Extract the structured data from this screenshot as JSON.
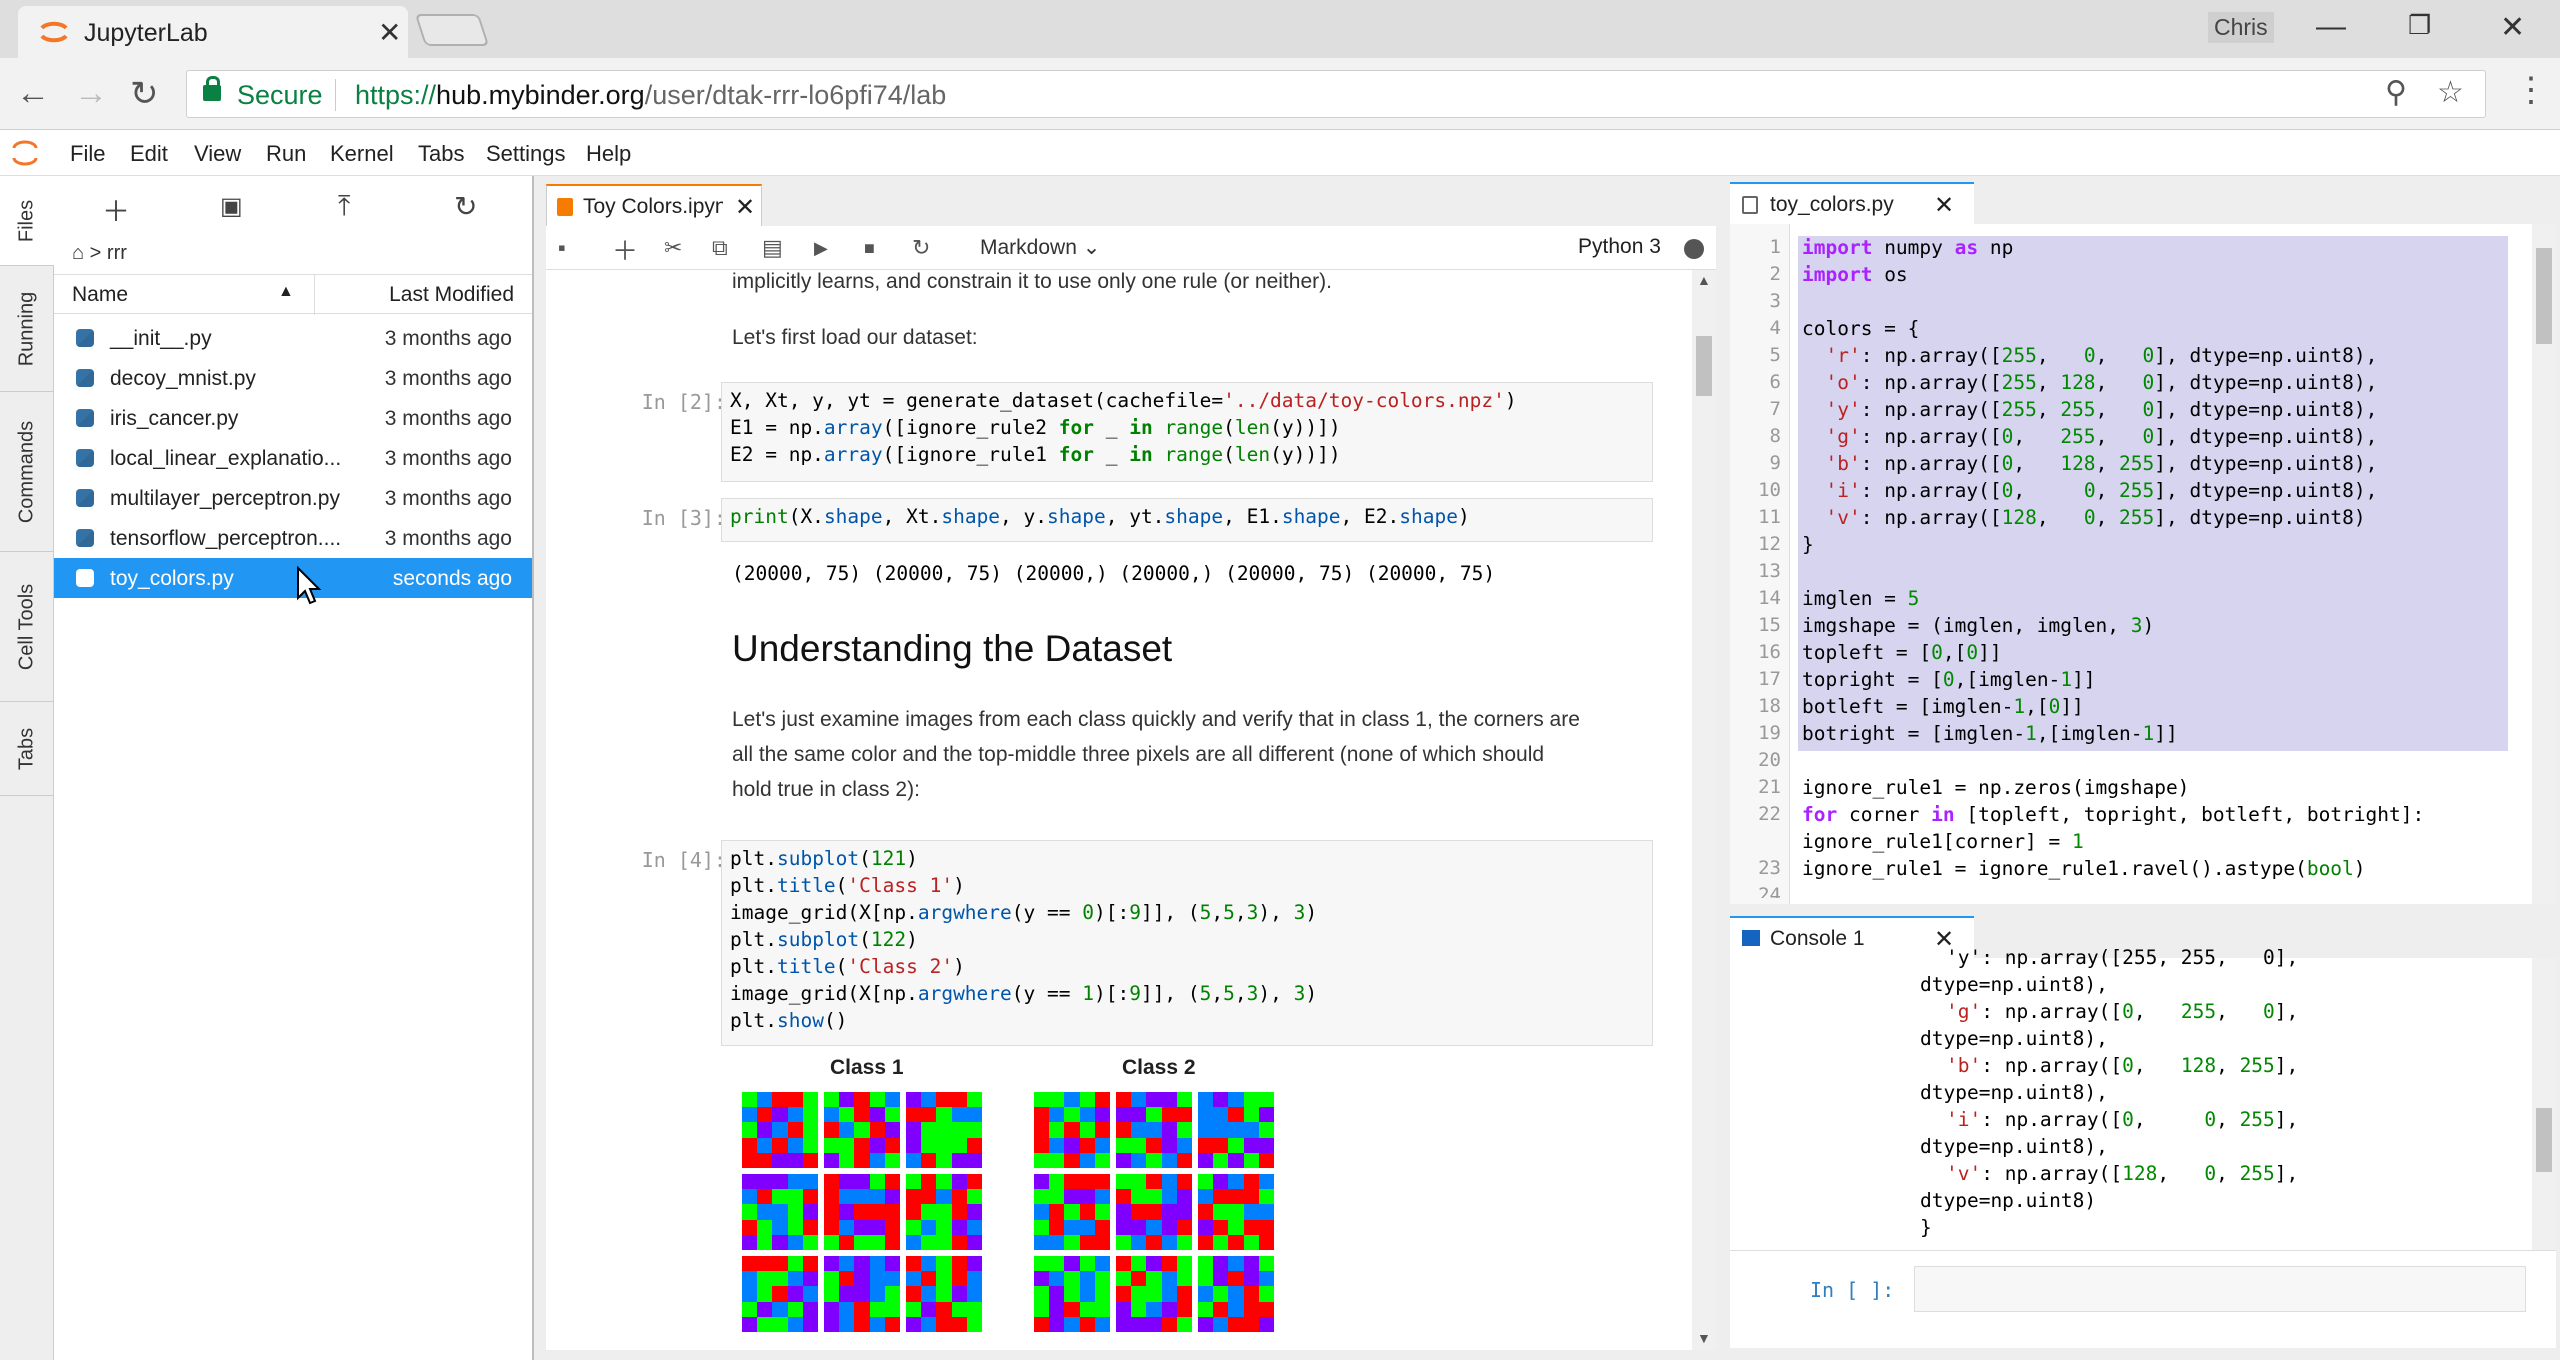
{
  "browser": {
    "tab_title": "JupyterLab",
    "user": "Chris",
    "secure_label": "Secure",
    "url_scheme": "https://",
    "url_host": "hub.mybinder.org",
    "url_path": "/user/dtak-rrr-lo6pfi74/lab"
  },
  "menu": [
    "File",
    "Edit",
    "View",
    "Run",
    "Kernel",
    "Tabs",
    "Settings",
    "Help"
  ],
  "sidetabs": [
    "Files",
    "Running",
    "Commands",
    "Cell Tools",
    "Tabs"
  ],
  "filebrowser": {
    "breadcrumb": "rrr",
    "col_name": "Name",
    "col_modified": "Last Modified",
    "files": [
      {
        "name": "__init__.py",
        "modified": "3 months ago"
      },
      {
        "name": "decoy_mnist.py",
        "modified": "3 months ago"
      },
      {
        "name": "iris_cancer.py",
        "modified": "3 months ago"
      },
      {
        "name": "local_linear_explanatio...",
        "modified": "3 months ago"
      },
      {
        "name": "multilayer_perceptron.py",
        "modified": "3 months ago"
      },
      {
        "name": "tensorflow_perceptron....",
        "modified": "3 months ago"
      },
      {
        "name": "toy_colors.py",
        "modified": "seconds ago"
      }
    ]
  },
  "notebook": {
    "tab_title": "Toy Colors.ipynb",
    "cell_type": "Markdown",
    "kernel": "Python 3",
    "md1": "implicitly learns, and constrain it to use only one rule (or neither).",
    "md2": "Let's first load our dataset:",
    "prompt2": "In [2]:",
    "prompt3": "In [3]:",
    "out3": "(20000, 75) (20000, 75) (20000,) (20000,) (20000, 75) (20000, 75)",
    "heading": "Understanding the Dataset",
    "md3_l1": "Let's just examine images from each class quickly and verify that in class 1, the corners are",
    "md3_l2": "all the same color and the top-middle three pixels are all different (none of which should",
    "md3_l3": "hold true in class 2):",
    "prompt4": "In [4]:",
    "class1": "Class 1",
    "class2": "Class 2"
  },
  "editor": {
    "tab_title": "toy_colors.py",
    "line_numbers": [
      "1",
      "2",
      "3",
      "4",
      "5",
      "6",
      "7",
      "8",
      "9",
      "10",
      "11",
      "12",
      "13",
      "14",
      "15",
      "16",
      "17",
      "18",
      "19",
      "20",
      "21",
      "22",
      "",
      "23",
      "24"
    ]
  },
  "console": {
    "tab_title": "Console 1",
    "prompt": "In [ ]:"
  },
  "colors": {
    "accent": "#2196f3",
    "notebook_orange": "#f57c00",
    "selection": "#d7d4f0"
  }
}
